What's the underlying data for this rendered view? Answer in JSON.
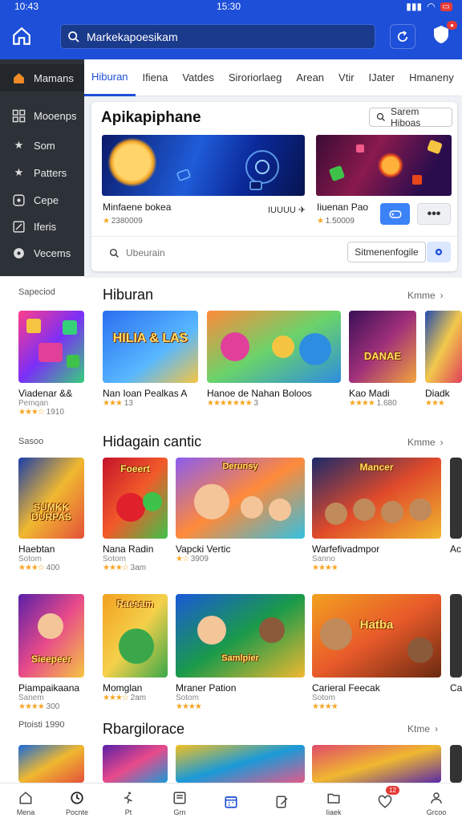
{
  "status": {
    "time": "10:43",
    "center": "15:30",
    "battery": ""
  },
  "header": {
    "search_value": "Markekapoesikam",
    "search_placeholder": "Markekapoesikam"
  },
  "sidebar": {
    "items": [
      {
        "label": "Mamans",
        "icon": "home-icon"
      },
      {
        "label": "Mooenps",
        "icon": "grid-icon"
      },
      {
        "label": "Som",
        "icon": "star-icon"
      },
      {
        "label": "Patters",
        "icon": "star-icon"
      },
      {
        "label": "Cepe",
        "icon": "gamepad-icon"
      },
      {
        "label": "Iferis",
        "icon": "edit-icon"
      },
      {
        "label": "Vecems",
        "icon": "globe-icon"
      }
    ]
  },
  "tabs": [
    "Hiburan",
    "Ifiena",
    "Vatdes",
    "Siroriorlaeg",
    "Arean",
    "Vtir",
    "IJater",
    "Hmaneny"
  ],
  "featured": {
    "title": "Apikapiphane",
    "search_button": "Sarem Hiboas",
    "banner1": {
      "name": "Minfaene bokea",
      "rating": "2380009",
      "extra": "IUUUU"
    },
    "banner2": {
      "name": "Iiuenan Pao",
      "rating": "1.50009"
    },
    "search_placeholder": "Ubeurain",
    "sub_button": "Sitmenenfogile"
  },
  "sections": [
    {
      "side_label": "Sapeciod",
      "title": "Hiburan",
      "more": "Kmme",
      "cards": [
        {
          "name": "Viadenar &&",
          "sub": "Pemqan",
          "stars": "★★★☆",
          "rating": "1910",
          "thumb_text": "",
          "colors": [
            "#ff3d8a",
            "#7b2ff7",
            "#36d07a"
          ]
        },
        {
          "name": "Nan Ioan Pealkas A",
          "sub": "",
          "stars": "★★★",
          "rating": "13",
          "thumb_text": "HILIA & LAS",
          "colors": [
            "#2a6ef0",
            "#58b8ff",
            "#f5c542"
          ]
        },
        {
          "name": "Hanoe de Nahan Boloos",
          "sub": "",
          "stars": "★★★★★★★",
          "rating": "3",
          "thumb_text": "",
          "colors": [
            "#ff8a3a",
            "#6ad36a",
            "#2d8de0"
          ]
        },
        {
          "name": "Kao Madi",
          "sub": "",
          "stars": "★★★★",
          "rating": "1.680",
          "thumb_text": "DANAE",
          "colors": [
            "#3a1056",
            "#a0307a",
            "#f2a43c"
          ]
        },
        {
          "name": "Diadk",
          "sub": "",
          "stars": "★★★",
          "rating": "",
          "thumb_text": "",
          "colors": [
            "#1f4ab0",
            "#f2c94c",
            "#e0405a"
          ]
        }
      ]
    },
    {
      "side_label": "Sasoo",
      "title": "Hidagain cantic",
      "more": "Kmme",
      "cards": [
        {
          "name": "Haebtan",
          "sub": "Sotom",
          "stars": "★★★☆",
          "rating": "400",
          "thumb_text": "SUMKK DURPAS",
          "colors": [
            "#1c3fa8",
            "#f0b830",
            "#e4513a"
          ]
        },
        {
          "name": "Nana Radin",
          "sub": "Sotom",
          "stars": "★★★☆",
          "rating": "3am",
          "thumb_text": "Foeert",
          "colors": [
            "#c4142a",
            "#f25a2a",
            "#3ec24a"
          ]
        },
        {
          "name": "Vapcki Vertic",
          "sub": "",
          "stars": "★☆",
          "rating": "3909",
          "thumb_text": "Derunsy",
          "colors": [
            "#8c5cf0",
            "#ff8a3a",
            "#34c0e0"
          ]
        },
        {
          "name": "Warfefivadmpor",
          "sub": "Sanno",
          "stars": "★★★★",
          "rating": "",
          "thumb_text": "Mancer",
          "colors": [
            "#1c2a6a",
            "#e04a2a",
            "#f0b830"
          ]
        },
        {
          "name": "Ac",
          "sub": "",
          "stars": "",
          "rating": "",
          "thumb_text": "",
          "colors": [
            "#333333",
            "#777777",
            "#aaaaaa"
          ]
        }
      ]
    },
    {
      "side_label": "",
      "title": "",
      "more": "",
      "cards": [
        {
          "name": "Piampaikaana",
          "sub": "Sanem",
          "stars": "★★★★",
          "rating": "300",
          "thumb_text": "Sieepeer",
          "colors": [
            "#5a20a8",
            "#e84a8a",
            "#f5c542"
          ]
        },
        {
          "name": "Momglan",
          "sub": "",
          "stars": "★★★☆",
          "rating": "2am",
          "thumb_text": "Raesam",
          "colors": [
            "#f2a020",
            "#f5d04a",
            "#3aa84a"
          ]
        },
        {
          "name": "Mraner Pation",
          "sub": "Sotom",
          "stars": "★★★★",
          "rating": "",
          "thumb_text": "Samlpier",
          "colors": [
            "#1a5ad8",
            "#1a9a4a",
            "#f0b830"
          ]
        },
        {
          "name": "Carieral Feecak",
          "sub": "Sotom",
          "stars": "★★★★",
          "rating": "",
          "thumb_text": "Hatba",
          "colors": [
            "#f2a020",
            "#e85a2a",
            "#6a2a10"
          ]
        },
        {
          "name": "Ca",
          "sub": "",
          "stars": "",
          "rating": "",
          "thumb_text": "",
          "colors": [
            "#333333",
            "#777777",
            "#aaaaaa"
          ]
        }
      ]
    },
    {
      "side_label": "Ptoisti 1990",
      "title": "Rbargilorace",
      "more": "Ktme",
      "cards": [
        {
          "name": "",
          "sub": "",
          "stars": "",
          "rating": "",
          "thumb_text": "",
          "colors": [
            "#1a6ad8",
            "#f0b830",
            "#e4513a"
          ]
        },
        {
          "name": "",
          "sub": "",
          "stars": "",
          "rating": "",
          "thumb_text": "",
          "colors": [
            "#5a20a8",
            "#e84a8a",
            "#1a9ad8"
          ]
        },
        {
          "name": "",
          "sub": "",
          "stars": "",
          "rating": "",
          "thumb_text": "",
          "colors": [
            "#f2c020",
            "#1a9ad8",
            "#e45a8a"
          ]
        },
        {
          "name": "",
          "sub": "",
          "stars": "",
          "rating": "",
          "thumb_text": "",
          "colors": [
            "#e04a6a",
            "#f0b830",
            "#5a2aa8"
          ]
        },
        {
          "name": "",
          "sub": "",
          "stars": "",
          "rating": "",
          "thumb_text": "",
          "colors": [
            "#333333",
            "#777777",
            "#aaaaaa"
          ]
        }
      ]
    }
  ],
  "bottom_nav": [
    {
      "label": "Mena",
      "icon": "home-icon"
    },
    {
      "label": "Pocnte",
      "icon": "clock-icon"
    },
    {
      "label": "Pt",
      "icon": "run-icon"
    },
    {
      "label": "Grn",
      "icon": "book-icon"
    },
    {
      "label": "",
      "icon": "calendar-icon",
      "active": true
    },
    {
      "label": "",
      "icon": "edit-icon"
    },
    {
      "label": "Iiaek",
      "icon": "folder-icon"
    },
    {
      "label": "",
      "icon": "heart-icon",
      "badge": "12"
    },
    {
      "label": "Grcoo",
      "icon": "user-icon"
    }
  ]
}
